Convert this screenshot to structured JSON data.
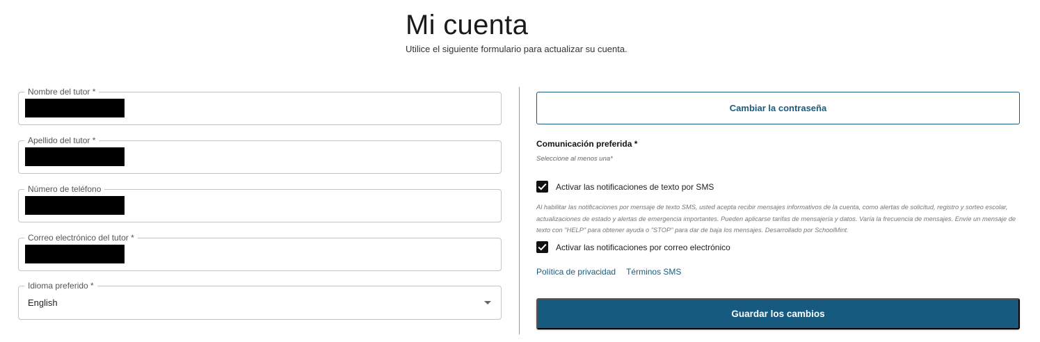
{
  "header": {
    "title": "Mi cuenta",
    "subtitle": "Utilice el siguiente formulario para actualizar su cuenta."
  },
  "form": {
    "guardian_first_name": {
      "label": "Nombre del tutor *",
      "value": ""
    },
    "guardian_last_name": {
      "label": "Apellido del tutor *",
      "value": ""
    },
    "phone": {
      "label": "Número de teléfono",
      "value": ""
    },
    "guardian_email": {
      "label": "Correo electrónico del tutor *",
      "value": ""
    },
    "language": {
      "label": "Idioma preferido *",
      "selected": "English"
    }
  },
  "account": {
    "change_password_label": "Cambiar la contraseña",
    "communication_title": "Comunicación preferida *",
    "communication_hint": "Seleccione al menos una*",
    "sms_option": {
      "label": "Activar las notificaciones de texto por SMS",
      "checked": true
    },
    "sms_disclaimer": "Al habilitar las notificaciones por mensaje de texto SMS, usted acepta recibir mensajes informativos de la cuenta, como alertas de solicitud, registro y sorteo escolar, actualizaciones de estado y alertas de emergencia importantes. Pueden aplicarse tarifas de mensajería y datos. Varía la frecuencia de mensajes. Envíe un mensaje de texto con \"HELP\" para obtener ayuda o \"STOP\" para dar de baja los mensajes. Desarrollado por SchoolMint.",
    "email_option": {
      "label": "Activar las notificaciones por correo electrónico",
      "checked": true
    },
    "privacy_link": "Política de privacidad",
    "sms_terms_link": "Términos SMS",
    "save_label": "Guardar los cambios"
  },
  "colors": {
    "brand": "#175a7f",
    "checkbox": "#111111",
    "border": "#c4c4c4"
  }
}
